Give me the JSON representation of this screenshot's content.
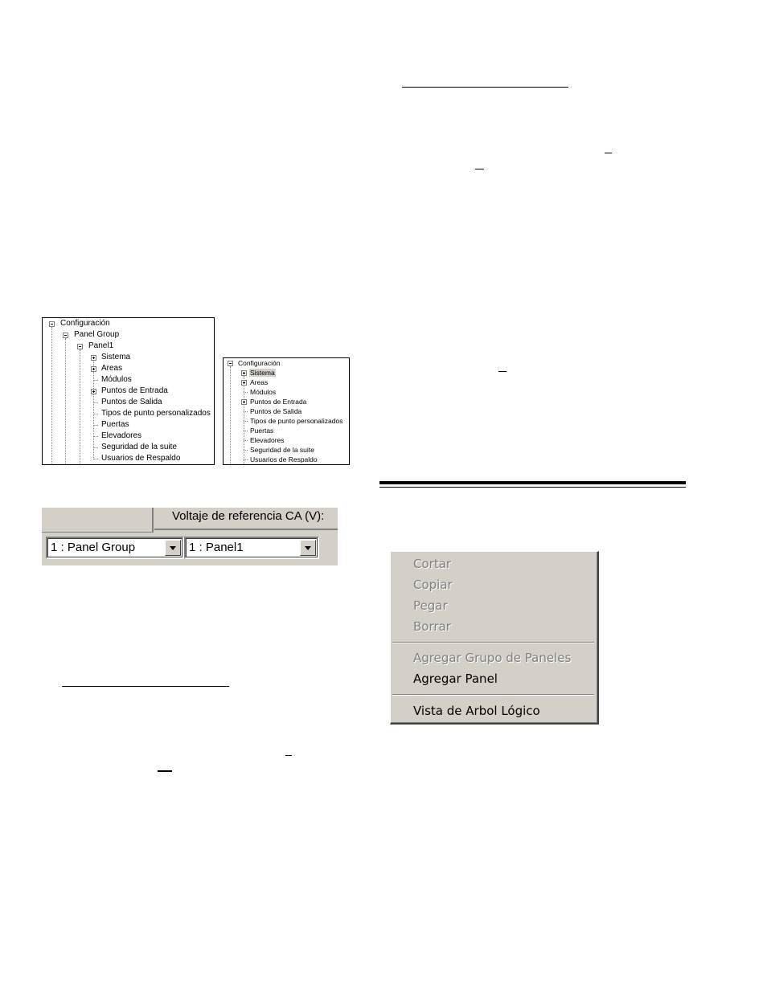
{
  "tree_large": {
    "items": [
      {
        "label": "Configuración",
        "expander": "minus"
      },
      {
        "label": "Panel Group",
        "expander": "minus"
      },
      {
        "label": "Panel1",
        "expander": "minus"
      },
      {
        "label": "Sistema",
        "expander": "plus"
      },
      {
        "label": "Areas",
        "expander": "plus"
      },
      {
        "label": "Módulos",
        "expander": "none"
      },
      {
        "label": "Puntos de Entrada",
        "expander": "plus"
      },
      {
        "label": "Puntos de Salida",
        "expander": "none"
      },
      {
        "label": "Tipos de punto personalizados",
        "expander": "none"
      },
      {
        "label": "Puertas",
        "expander": "none"
      },
      {
        "label": "Elevadores",
        "expander": "none"
      },
      {
        "label": "Seguridad de la suite",
        "expander": "none"
      },
      {
        "label": "Usuarios de Respaldo",
        "expander": "none"
      }
    ]
  },
  "tree_small": {
    "items": [
      {
        "label": "Configuración",
        "expander": "minus"
      },
      {
        "label": "Sistema",
        "expander": "plus",
        "selected": true
      },
      {
        "label": "Areas",
        "expander": "plus"
      },
      {
        "label": "Módulos",
        "expander": "none"
      },
      {
        "label": "Puntos de Entrada",
        "expander": "plus"
      },
      {
        "label": "Puntos de Salida",
        "expander": "none"
      },
      {
        "label": "Tipos de punto personalizados",
        "expander": "none"
      },
      {
        "label": "Puertas",
        "expander": "none"
      },
      {
        "label": "Elevadores",
        "expander": "none"
      },
      {
        "label": "Seguridad de la suite",
        "expander": "none"
      },
      {
        "label": "Usuarios de Respaldo",
        "expander": "none"
      }
    ]
  },
  "panel_selector": {
    "column_header": "Voltaje de referencia CA (V):",
    "group_value": "1 : Panel Group",
    "panel_value": "1 : Panel1"
  },
  "context_menu": {
    "cut": "Cortar",
    "copy": "Copiar",
    "paste": "Pegar",
    "delete": "Borrar",
    "add_group": "Agregar Grupo de Paneles",
    "add_panel": "Agregar Panel",
    "logical_tree": "Vista de Arbol Lógico"
  },
  "colors": {
    "face": "#d4d0c8",
    "shadow": "#808080",
    "disabled_text": "#808080"
  }
}
